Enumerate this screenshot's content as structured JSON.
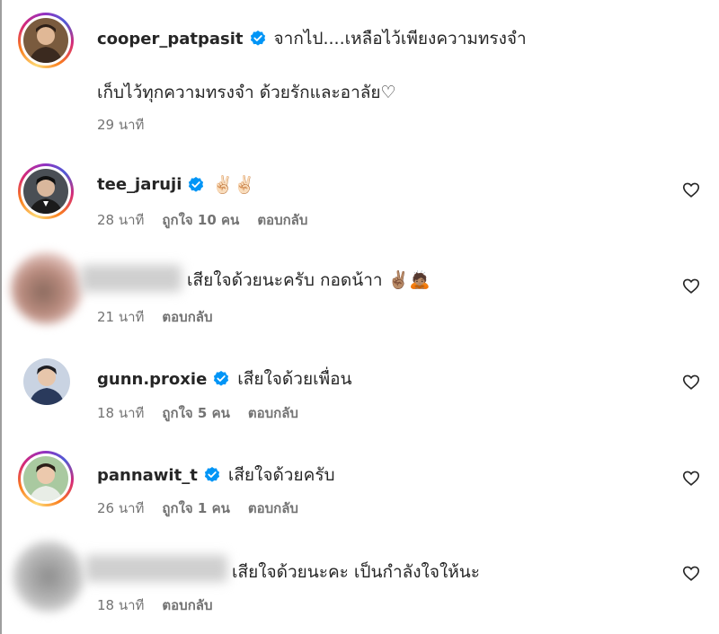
{
  "comments": [
    {
      "username": "cooper_patpasit",
      "verified": true,
      "text": "จากไป....เหลือไว้เพียงความทรงจำ",
      "text_line2": "เก็บไว้ทุกความทรงจำ ด้วยรักและอาลัย♡",
      "time": "29 นาที",
      "likes": "",
      "reply": ""
    },
    {
      "username": "tee_jaruji",
      "verified": true,
      "text": "✌🏻✌🏻",
      "time": "28 นาที",
      "likes": "ถูกใจ 10 คน",
      "reply": "ตอบกลับ"
    },
    {
      "username": "",
      "verified": false,
      "text": "เสียใจด้วยนะครับ กอดน้าา ✌🏽🙇🏽",
      "time": "21 นาที",
      "likes": "",
      "reply": "ตอบกลับ"
    },
    {
      "username": "gunn.proxie",
      "verified": true,
      "text": "เสียใจด้วยเพื่อน",
      "time": "18 นาที",
      "likes": "ถูกใจ 5 คน",
      "reply": "ตอบกลับ"
    },
    {
      "username": "pannawit_t",
      "verified": true,
      "text": "เสียใจด้วยครับ",
      "time": "26 นาที",
      "likes": "ถูกใจ 1 คน",
      "reply": "ตอบกลับ"
    },
    {
      "username": "",
      "verified": false,
      "text": "เสียใจด้วยนะคะ เป็นกำลังใจให้นะ",
      "time": "18 นาที",
      "likes": "",
      "reply": "ตอบกลับ"
    }
  ],
  "icons": {
    "verified": "verified-badge-icon",
    "like": "heart-outline-icon"
  },
  "colors": {
    "verified_blue": "#0095f6",
    "meta_gray": "#737373",
    "text": "#262626"
  }
}
